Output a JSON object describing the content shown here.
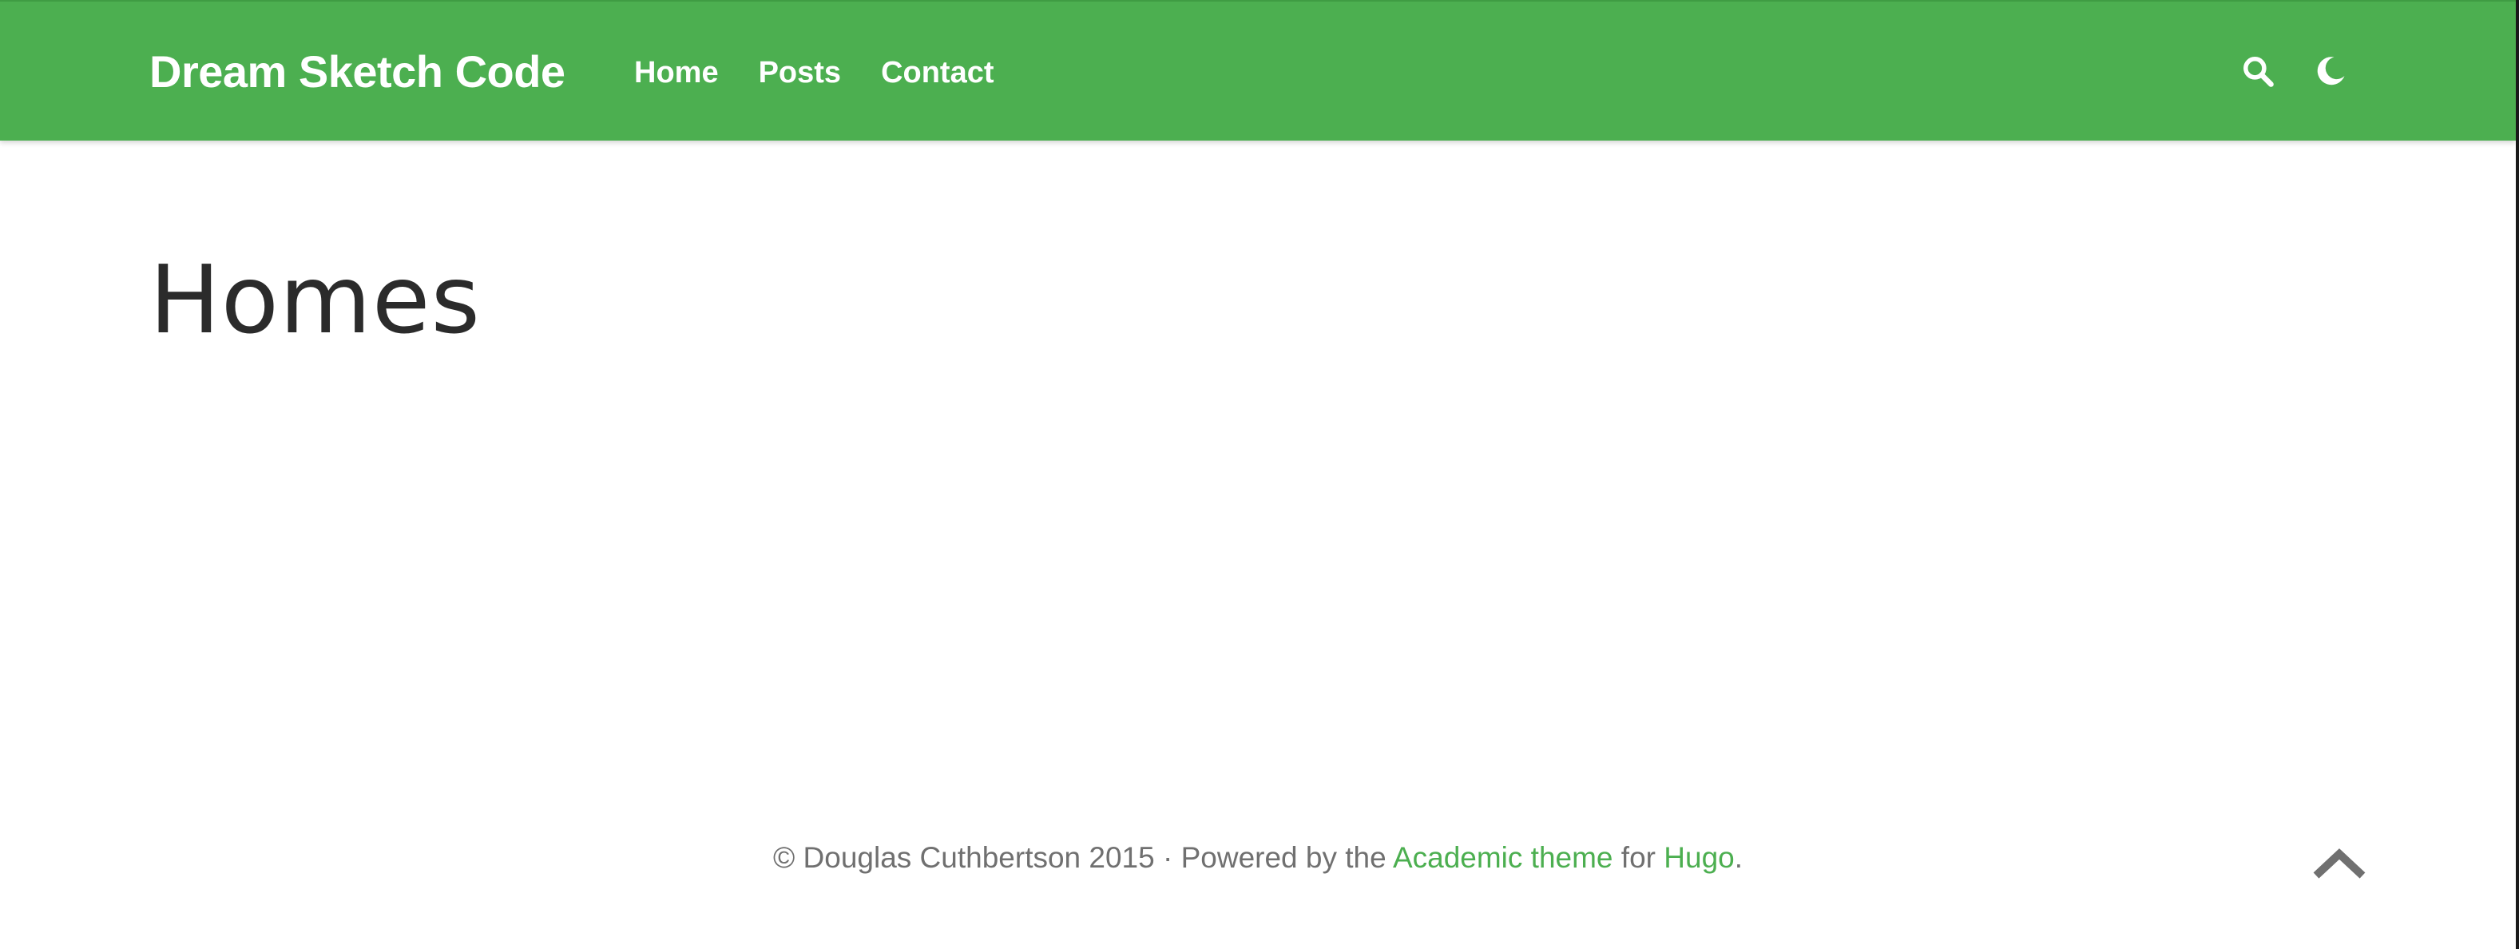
{
  "navbar": {
    "brand": "Dream Sketch Code",
    "links": [
      {
        "label": "Home"
      },
      {
        "label": "Posts"
      },
      {
        "label": "Contact"
      }
    ],
    "search_icon": "search-icon",
    "theme_icon": "moon-icon"
  },
  "main": {
    "title": "Homes"
  },
  "footer": {
    "copyright": "© Douglas Cuthbertson 2015 · Powered by the ",
    "theme_link": "Academic theme",
    "for_text": " for ",
    "hugo_link": "Hugo",
    "period": "."
  },
  "back_to_top_icon": "chevron-up-icon",
  "colors": {
    "primary": "#4caf50",
    "text_dark": "#2b2b2b",
    "text_muted": "#707070",
    "back_to_top": "#707070"
  }
}
